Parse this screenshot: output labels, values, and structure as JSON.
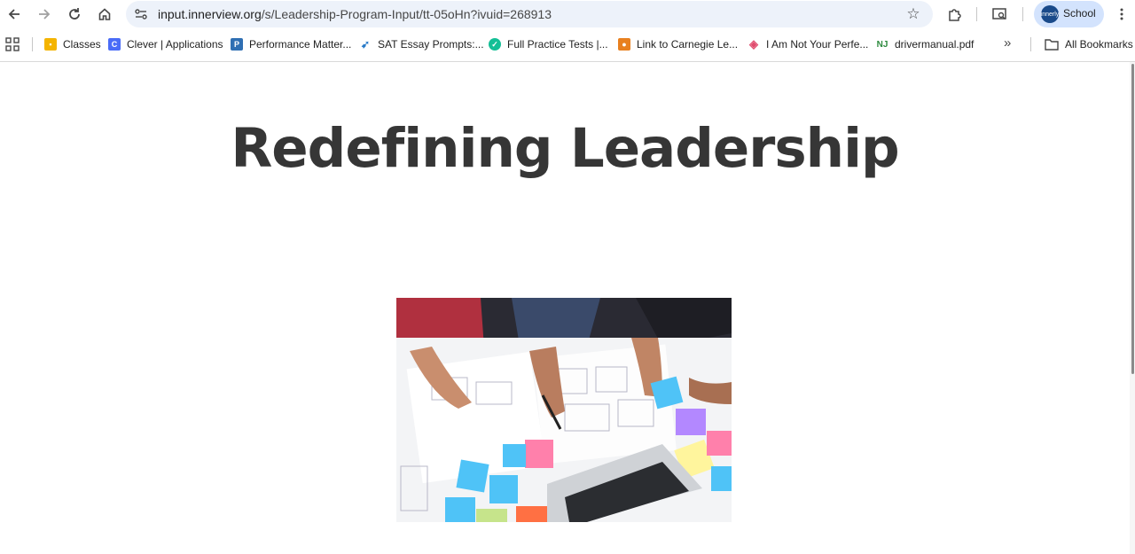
{
  "browser": {
    "url_host": "input.innerview.org",
    "url_path": "/s/Leadership-Program-Input/tt-05oHn?ivuid=268913",
    "profile_name": "School",
    "profile_avatar_text": "innerly"
  },
  "bookmarks": {
    "items": [
      {
        "label": "Classes",
        "icon": "google-classroom-icon",
        "color": "#f4b400"
      },
      {
        "label": "Clever | Applications",
        "icon": "clever-icon",
        "color": "#4a6cf7"
      },
      {
        "label": "Performance Matter...",
        "icon": "performance-matters-icon",
        "color": "#2f6fb3"
      },
      {
        "label": "SAT Essay Prompts:...",
        "icon": "sat-icon",
        "color": "#2a7bc8"
      },
      {
        "label": "Full Practice Tests |...",
        "icon": "khan-academy-icon",
        "color": "#14bf96"
      },
      {
        "label": "Link to Carnegie Le...",
        "icon": "carnegie-icon",
        "color": "#e8801f"
      },
      {
        "label": "I Am Not Your Perfe...",
        "icon": "diamond-icon",
        "color": "#e04a6c"
      },
      {
        "label": "drivermanual.pdf",
        "icon": "nj-icon",
        "color": "#2d8a3e"
      }
    ],
    "all_bookmarks_label": "All Bookmarks"
  },
  "page": {
    "title": "Redefining Leadership",
    "image_icon": "team-brainstorm-photo"
  },
  "colors": {
    "title": "#363636",
    "omnibox_bg": "#edf2fa",
    "profile_bg": "#d3e3fd"
  }
}
